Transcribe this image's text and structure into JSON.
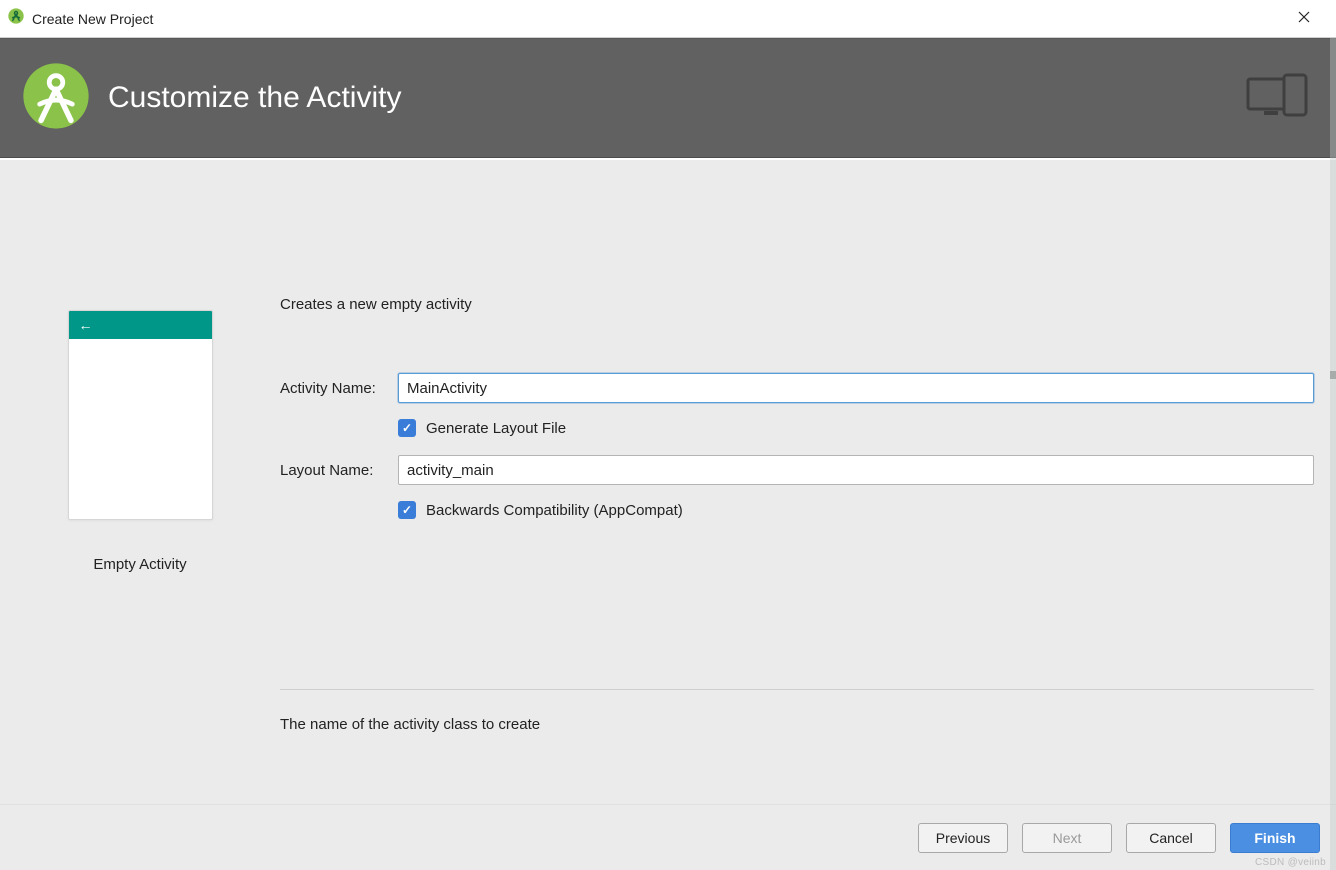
{
  "window": {
    "title": "Create New Project"
  },
  "banner": {
    "title": "Customize the Activity"
  },
  "preview": {
    "label": "Empty Activity"
  },
  "form": {
    "subtitle": "Creates a new empty activity",
    "activity_name_label": "Activity Name:",
    "activity_name_value": "MainActivity",
    "layout_name_label": "Layout Name:",
    "layout_name_value": "activity_main",
    "generate_layout_label": "Generate Layout File",
    "generate_layout_checked": true,
    "backwards_compat_label": "Backwards Compatibility (AppCompat)",
    "backwards_compat_checked": true,
    "hint": "The name of the activity class to create"
  },
  "footer": {
    "previous": "Previous",
    "next": "Next",
    "cancel": "Cancel",
    "finish": "Finish"
  },
  "watermark": "CSDN @veiinb"
}
